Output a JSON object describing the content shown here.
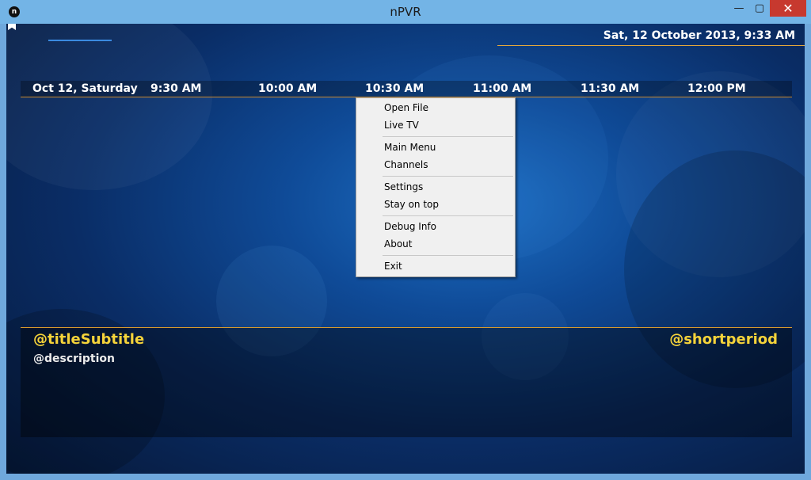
{
  "window": {
    "title": "nPVR",
    "icon_letter": "n",
    "controls": {
      "minimize": "—",
      "maximize": "▢",
      "close": "✕"
    }
  },
  "header": {
    "clock": "Sat, 12 October 2013, 9:33 AM"
  },
  "timeline": {
    "date": "Oct 12, Saturday",
    "times": [
      "9:30 AM",
      "10:00 AM",
      "10:30 AM",
      "11:00 AM",
      "11:30 AM",
      "12:00 PM"
    ]
  },
  "menu": {
    "groups": [
      [
        "Open File",
        "Live TV"
      ],
      [
        "Main Menu",
        "Channels"
      ],
      [
        "Settings",
        "Stay on top"
      ],
      [
        "Debug Info",
        "About"
      ],
      [
        "Exit"
      ]
    ]
  },
  "info": {
    "title_subtitle": "@titleSubtitle",
    "short_period": "@shortperiod",
    "description": "@description"
  },
  "colors": {
    "accent": "#f5d33a",
    "line": "#d49a2e",
    "titlebar": "#73b4e6",
    "close": "#c7392f"
  }
}
